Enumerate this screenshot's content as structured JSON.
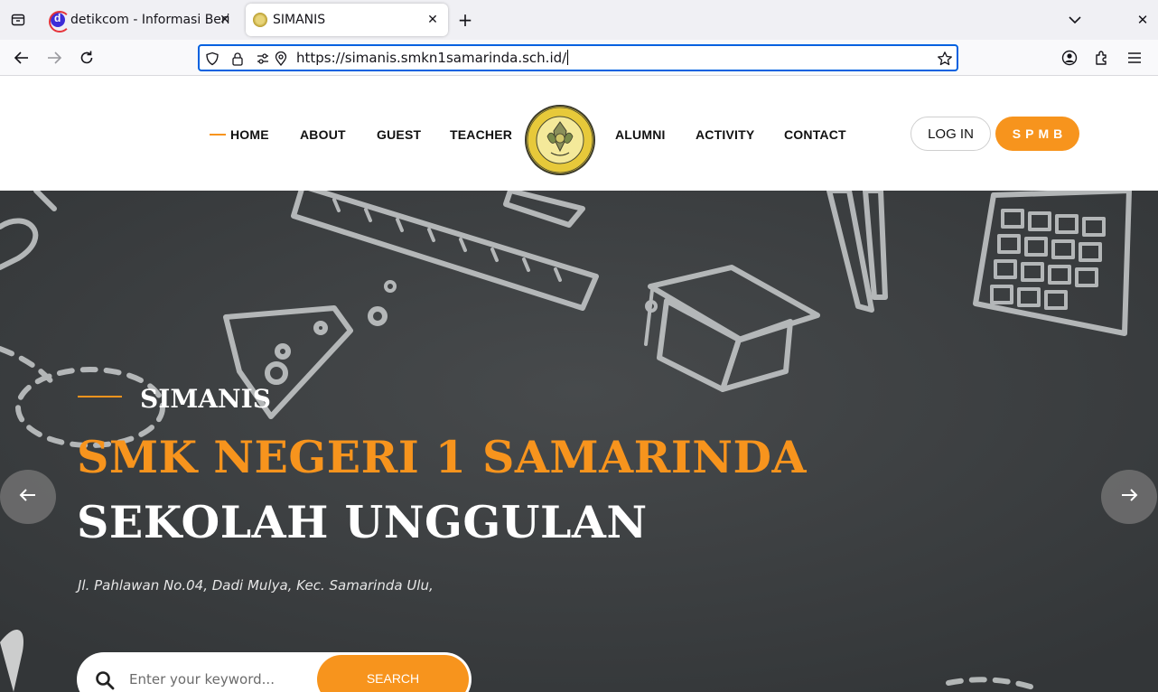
{
  "browser": {
    "tabs": [
      {
        "title": "detikcom - Informasi Berit",
        "active": false
      },
      {
        "title": "SIMANIS",
        "active": true
      }
    ],
    "url": "https://simanis.smkn1samarinda.sch.id/"
  },
  "nav": {
    "items": [
      "HOME",
      "ABOUT",
      "GUEST",
      "TEACHER",
      "ALUMNI",
      "ACTIVITY",
      "CONTACT"
    ],
    "active": "HOME",
    "login_label": "LOG IN",
    "spmb_label": "SPMB"
  },
  "hero": {
    "kicker": "SIMANIS",
    "title_line1": "SMK NEGERI 1 SAMARINDA",
    "title_line2": "SEKOLAH UNGGULAN",
    "address": "Jl. Pahlawan No.04, Dadi Mulya, Kec. Samarinda Ulu,"
  },
  "search": {
    "placeholder": "Enter your keyword...",
    "button_label": "SEARCH"
  },
  "colors": {
    "accent": "#f7941d",
    "hero_bg": "#3d4042",
    "url_focus": "#0061e0"
  },
  "icons": {
    "tab_list": "tab-list-icon",
    "back": "back-arrow-icon",
    "forward": "forward-arrow-icon",
    "reload": "reload-icon",
    "shield": "shield-icon",
    "lock": "lock-icon",
    "permissions": "permissions-icon",
    "location": "location-icon",
    "bookmark": "star-icon",
    "account": "account-icon",
    "extensions": "extensions-icon",
    "menu": "hamburger-menu-icon",
    "prev_slide": "arrow-left-icon",
    "next_slide": "arrow-right-icon",
    "search": "search-icon"
  }
}
